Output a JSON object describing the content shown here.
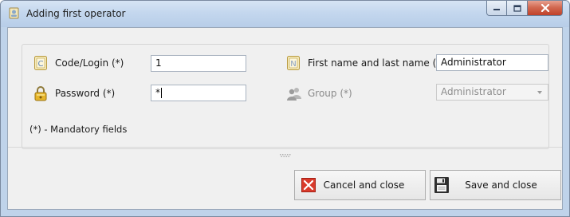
{
  "window": {
    "title": "Adding first operator",
    "app_icon": "operator-app-icon",
    "controls": [
      "minimize-icon",
      "maximize-icon",
      "close-icon"
    ]
  },
  "form": {
    "code_login": {
      "label": "Code/Login (*)",
      "value": "1",
      "icon": "code-card-icon"
    },
    "password": {
      "label": "Password (*)",
      "value": "*",
      "icon": "padlock-icon"
    },
    "full_name": {
      "label": "First name and last name (*)",
      "value": "Administrator",
      "icon": "name-card-icon"
    },
    "group": {
      "label": "Group (*)",
      "value": "Administrator",
      "icon": "users-group-icon",
      "disabled": true
    }
  },
  "mandatory_note": "(*) - Mandatory fields",
  "buttons": {
    "cancel": {
      "label": "Cancel and close",
      "icon": "red-x-icon"
    },
    "save": {
      "label": "Save and close",
      "icon": "floppy-disk-icon"
    }
  },
  "colors": {
    "title_bar": "#c4d7ee",
    "close_button": "#c0412a",
    "cancel_icon": "#d93a2b",
    "panel_bg": "#f0f0f0"
  }
}
